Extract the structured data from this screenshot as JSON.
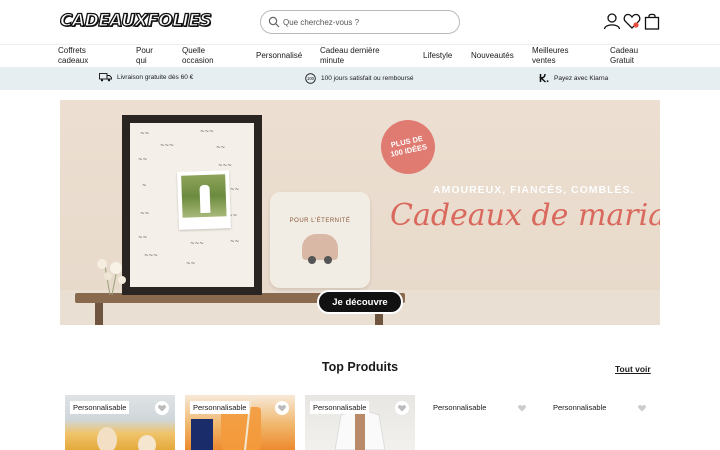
{
  "brand": {
    "logo_text": "CADEAUXFOLIES"
  },
  "search": {
    "placeholder": "Que cherchez-vous ?"
  },
  "header_icons": [
    "user-icon",
    "heart-icon",
    "bag-icon"
  ],
  "nav": {
    "items": [
      {
        "label": "Coffrets\ncadeaux"
      },
      {
        "label": "Pour\nqui"
      },
      {
        "label": "Quelle\noccasion"
      },
      {
        "label": "Personnalisé"
      },
      {
        "label": "Cadeau dernière\nminute"
      },
      {
        "label": "Lifestyle"
      },
      {
        "label": "Nouveautés"
      },
      {
        "label": "Meilleures\nventes"
      },
      {
        "label": "Cadeau\nGratuit"
      }
    ]
  },
  "usp": [
    {
      "icon": "truck-icon",
      "text": "Livraison gratuite dès 60 €"
    },
    {
      "icon": "satisfaction-icon",
      "text": "100 jours satisfait ou remboursé"
    },
    {
      "icon": "klarna-icon",
      "text": "Payez avec Klarna"
    }
  ],
  "banner": {
    "badge": "PLUS DE\n100 IDÉES",
    "subheading": "AMOUREUX, FIANCÉS, COMBLÉS.",
    "heading": "Cadeaux de mariage",
    "cta_label": "Je découvre",
    "pillow_text": "POUR L'ÉTERNITÉ"
  },
  "products_section": {
    "title": "Top Produits",
    "see_all_label": "Tout voir",
    "cards": [
      {
        "tag": "Personnalisable"
      },
      {
        "tag": "Personnalisable"
      },
      {
        "tag": "Personnalisable"
      },
      {
        "tag": "Personnalisable"
      },
      {
        "tag": "Personnalisable"
      }
    ]
  },
  "colors": {
    "usp_bg": "#e6eef2",
    "banner_accent": "#d9685d",
    "badge": "#e07b72",
    "cta_bg": "#111111"
  }
}
